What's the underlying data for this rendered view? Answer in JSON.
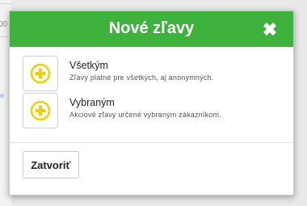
{
  "background": {
    "partial_text": "00"
  },
  "modal": {
    "title": "Nové zľavy",
    "close_icon": "close-x-icon",
    "header_color": "#3fb13d",
    "accent_color": "#f0d000",
    "options": [
      {
        "icon": "plus-circle-icon",
        "title": "Všetkým",
        "description": "Zľavy platné pre všetkých, aj anonymných."
      },
      {
        "icon": "plus-circle-icon",
        "title": "Vybraným",
        "description": "Akciové zľavy určené vybraným zákazníkom."
      }
    ],
    "close_button_label": "Zatvoriť"
  }
}
